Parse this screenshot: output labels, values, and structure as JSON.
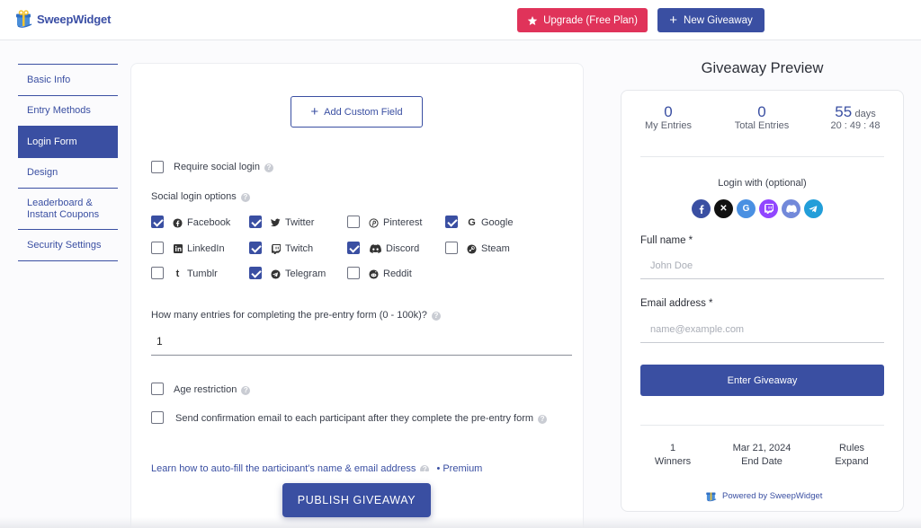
{
  "header": {
    "logo_text": "SweepWidget",
    "upgrade_label": "Upgrade (Free Plan)",
    "new_giveaway_label": "New Giveaway"
  },
  "sidebar": {
    "items": [
      {
        "label": "Basic Info",
        "active": false
      },
      {
        "label": "Entry Methods",
        "active": false
      },
      {
        "label": "Login Form",
        "active": true
      },
      {
        "label": "Design",
        "active": false
      },
      {
        "label": "Leaderboard &\nInstant Coupons",
        "active": false
      },
      {
        "label": "Security Settings",
        "active": false
      }
    ]
  },
  "form": {
    "add_custom_field_label": "Add Custom Field",
    "require_social_login": {
      "label": "Require social login",
      "checked": false
    },
    "social_options_heading": "Social login options",
    "social_options": [
      {
        "label": "Facebook",
        "icon": "facebook-icon",
        "checked": true
      },
      {
        "label": "Twitter",
        "icon": "twitter-icon",
        "checked": true
      },
      {
        "label": "Pinterest",
        "icon": "pinterest-icon",
        "checked": false
      },
      {
        "label": "Google",
        "icon": "google-icon",
        "checked": true
      },
      {
        "label": "LinkedIn",
        "icon": "linkedin-icon",
        "checked": false
      },
      {
        "label": "Twitch",
        "icon": "twitch-icon",
        "checked": true
      },
      {
        "label": "Discord",
        "icon": "discord-icon",
        "checked": true
      },
      {
        "label": "Steam",
        "icon": "steam-icon",
        "checked": false
      },
      {
        "label": "Tumblr",
        "icon": "tumblr-icon",
        "checked": false
      },
      {
        "label": "Telegram",
        "icon": "telegram-icon",
        "checked": true
      },
      {
        "label": "Reddit",
        "icon": "reddit-icon",
        "checked": false
      }
    ],
    "entries_question": "How many entries for completing the pre-entry form (0 - 100k)?",
    "entries_value": "1",
    "age_restriction": {
      "label": "Age restriction",
      "checked": false
    },
    "send_confirmation": {
      "label": "Send confirmation email to each participant after they complete the pre-entry form",
      "checked": false
    },
    "autofill_link": "Learn how to auto-fill the participant's name & email address",
    "premium_label": "• Premium",
    "publish_label": "PUBLISH GIVEAWAY"
  },
  "preview": {
    "title": "Giveaway Preview",
    "my_entries": {
      "value": "0",
      "label": "My Entries"
    },
    "total_entries": {
      "value": "0",
      "label": "Total Entries"
    },
    "days": {
      "value": "55",
      "unit": "days",
      "time": "20 : 49 : 48"
    },
    "login_with": "Login with (optional)",
    "full_name_label": "Full name *",
    "full_name_placeholder": "John Doe",
    "email_label": "Email address *",
    "email_placeholder": "name@example.com",
    "enter_label": "Enter Giveaway",
    "winners": {
      "value": "1",
      "label": "Winners"
    },
    "end_date": {
      "value": "Mar 21, 2024",
      "label": "End Date"
    },
    "rules": {
      "value": "Rules",
      "label": "Expand"
    },
    "powered_by": "Powered by SweepWidget"
  },
  "colors": {
    "brand": "#3a4fa2",
    "upgrade": "#e0335a"
  }
}
